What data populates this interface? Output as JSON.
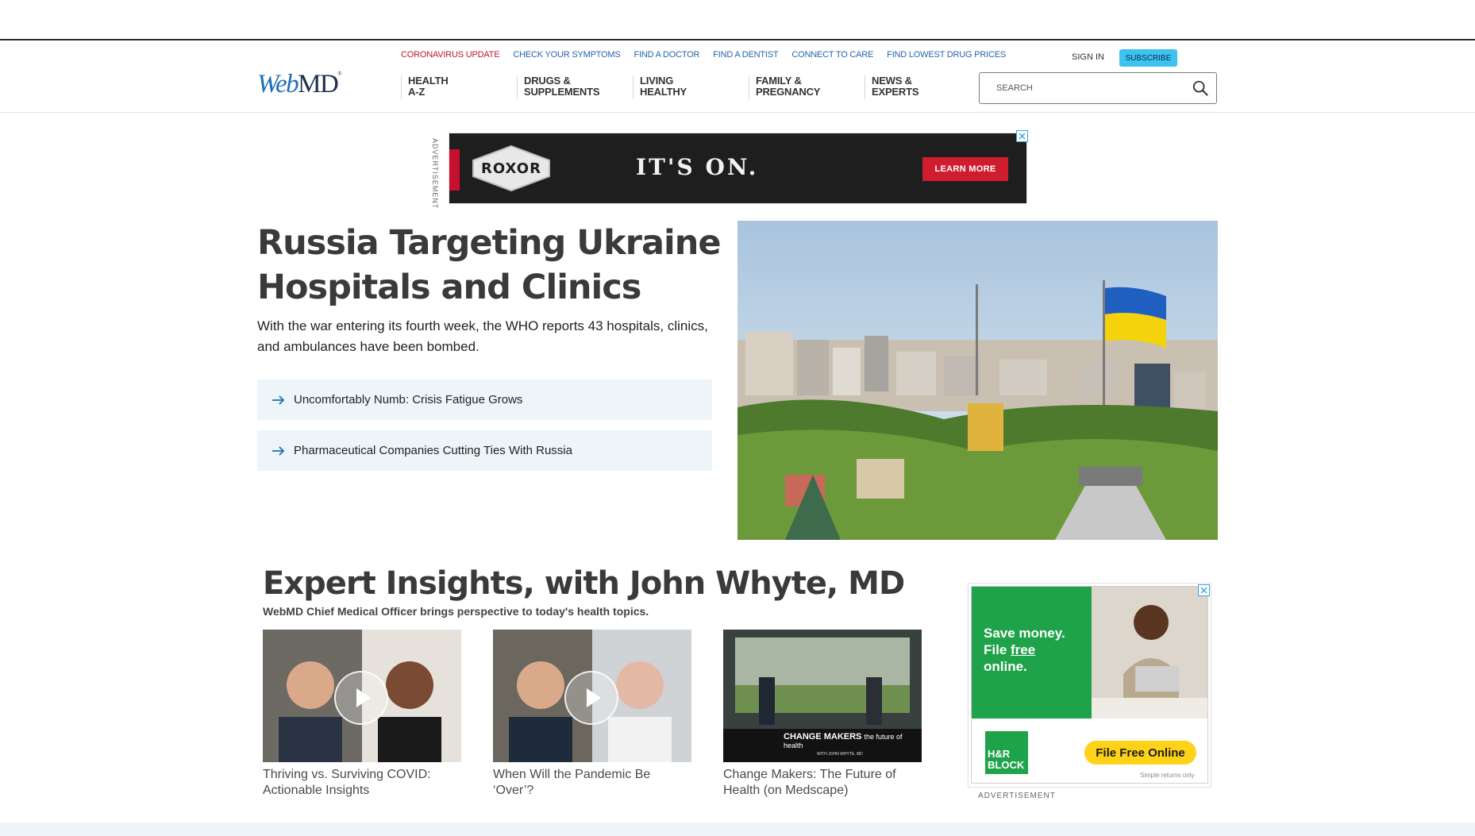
{
  "header": {
    "utility_links": [
      {
        "label": "CORONAVIRUS UPDATE",
        "alert": true
      },
      {
        "label": "CHECK YOUR SYMPTOMS",
        "alert": false
      },
      {
        "label": "FIND A DOCTOR",
        "alert": false
      },
      {
        "label": "FIND A DENTIST",
        "alert": false
      },
      {
        "label": "CONNECT TO CARE",
        "alert": false
      },
      {
        "label": "FIND LOWEST DRUG PRICES",
        "alert": false
      }
    ],
    "signin_label": "SIGN IN",
    "subscribe_label": "SUBSCRIBE",
    "logo": {
      "part1": "Web",
      "part2": "MD",
      "mark": "®"
    },
    "nav": [
      {
        "label": "HEALTH\nA-Z"
      },
      {
        "label": "DRUGS &\nSUPPLEMENTS"
      },
      {
        "label": "LIVING\nHEALTHY"
      },
      {
        "label": "FAMILY &\nPREGNANCY"
      },
      {
        "label": "NEWS &\nEXPERTS"
      }
    ],
    "search": {
      "placeholder": "SEARCH",
      "icon": "search-icon"
    }
  },
  "top_ad": {
    "label": "ADVERTISEMENT",
    "brand": "ROXOR",
    "headline": "IT'S ON.",
    "cta": "LEARN MORE",
    "colors": {
      "bg": "#1e1e1e",
      "cta": "#d01c2f"
    }
  },
  "hero": {
    "title": "Russia Targeting Ukraine Hospitals and Clinics",
    "subtitle": "With the war entering its fourth week, the WHO reports 43 hospitals, clinics, and ambulances have been bombed.",
    "related": [
      {
        "label": "Uncomfortably Numb: Crisis Fatigue Grows"
      },
      {
        "label": "Pharmaceutical Companies Cutting Ties With Russia"
      }
    ],
    "image_alt": "Kyiv skyline with Ukrainian flag"
  },
  "expert": {
    "title": "Expert Insights, with John Whyte, MD",
    "subtitle": "WebMD Chief Medical Officer brings perspective to today's health topics.",
    "cards": [
      {
        "caption": "Thriving vs. Surviving COVID: Actionable Insights"
      },
      {
        "caption": "When Will the Pandemic Be ‘Over’?"
      },
      {
        "caption": "Change Makers: The Future of Health (on Medscape)"
      }
    ],
    "card3_overlay": {
      "title": "CHANGE MAKERS",
      "tag": "the future of health",
      "with": "WITH JOHN WHYTE, MD"
    }
  },
  "side_ad": {
    "line1": "Save money.",
    "line2a": "File ",
    "line2b": "free",
    "line3": "online.",
    "logo_top": "H&R",
    "logo_bottom": "BLOCK",
    "cta": "File Free Online",
    "tagline": "Simple returns only",
    "label": "ADVERTISEMENT",
    "colors": {
      "green": "#1fa34a",
      "cta": "#ffd21a"
    }
  },
  "colors": {
    "link": "#2567a9",
    "alert": "#c0182a",
    "subscribe": "#3ec3f0",
    "related_bg": "#eef5f9"
  }
}
